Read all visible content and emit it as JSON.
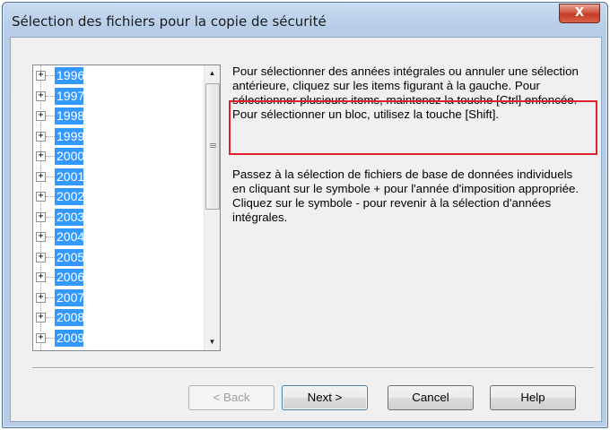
{
  "window": {
    "title": "Sélection des fichiers pour la copie de sécurité",
    "close_glyph": "X"
  },
  "tree": {
    "expander_glyph": "+",
    "items": [
      "1996",
      "1997",
      "1998",
      "1999",
      "2000",
      "2001",
      "2002",
      "2003",
      "2004",
      "2005",
      "2006",
      "2007",
      "2008",
      "2009"
    ],
    "selection_color": "#3399ff"
  },
  "instructions": {
    "paragraph1": "Pour sélectionner des années intégrales ou annuler une sélection antérieure, cliquez sur les items figurant à la gauche. Pour sélectionner plusieurs items, maintenez la touche [Ctrl] enfoncée. Pour sélectionner un bloc, utilisez la touche [Shift].",
    "paragraph2": "Passez à la sélection de fichiers de base de données individuels en cliquant sur le symbole + pour l'année d'imposition appropriée. Cliquez sur le symbole - pour revenir à la sélection d'années intégrales."
  },
  "annotation": {
    "highlight_color": "#e0202a"
  },
  "buttons": {
    "back": "< Back",
    "next": "Next >",
    "cancel": "Cancel",
    "help": "Help"
  }
}
